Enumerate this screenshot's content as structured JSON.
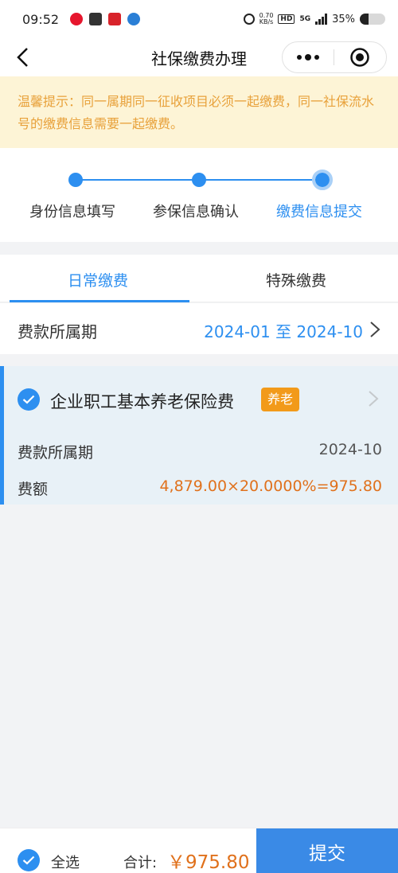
{
  "status_bar": {
    "time": "09:52",
    "net_speed_value": "0.70",
    "net_speed_unit": "KB/s",
    "hd": "HD",
    "network": "5G",
    "battery": "35%",
    "battery_level": 0.35
  },
  "nav": {
    "title": "社保缴费办理"
  },
  "tip": {
    "text": "温馨提示：同一属期同一征收项目必须一起缴费，同一社保流水号的缴费信息需要一起缴费。"
  },
  "steps": [
    {
      "label": "身份信息填写"
    },
    {
      "label": "参保信息确认"
    },
    {
      "label": "缴费信息提交"
    }
  ],
  "tabs": [
    {
      "label": "日常缴费"
    },
    {
      "label": "特殊缴费"
    }
  ],
  "period": {
    "label": "费款所属期",
    "value": "2024-01 至 2024-10"
  },
  "item": {
    "name": "企业职工基本养老保险费",
    "tag": "养老",
    "period_label": "费款所属期",
    "period_value": "2024-10",
    "amount_label": "费额",
    "amount_value": "4,879.00×20.0000%=975.80"
  },
  "bottom": {
    "select_all": "全选",
    "total_label": "合计:",
    "total_value": "￥975.80",
    "submit": "提交"
  },
  "colors": {
    "accent": "#2d8ff0",
    "warning_text": "#e8a13a",
    "warning_bg": "#fdf4d6",
    "amount": "#e0711c",
    "tag": "#f29a1a"
  }
}
